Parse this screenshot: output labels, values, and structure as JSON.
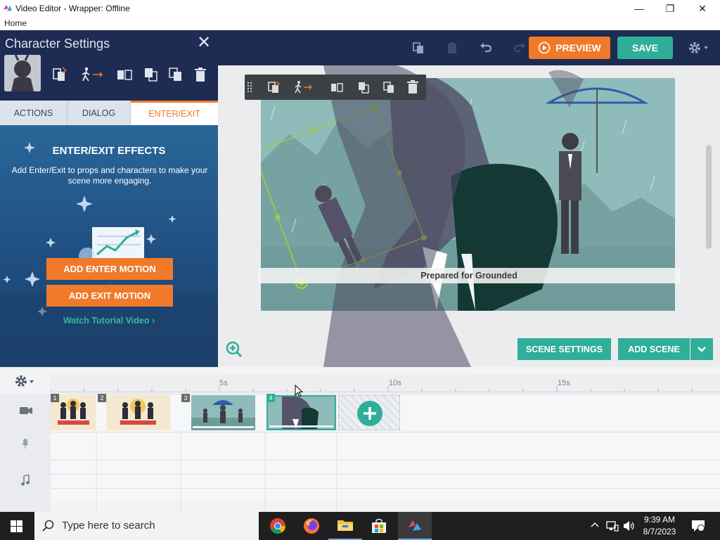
{
  "window": {
    "title": "Video Editor - Wrapper: Offline",
    "minimize": "—",
    "maximize": "❐",
    "close": "✕"
  },
  "menu": {
    "home": "Home"
  },
  "toolbar": {
    "preview_label": "PREVIEW",
    "save_label": "SAVE"
  },
  "panel": {
    "title": "Character Settings",
    "tabs": [
      {
        "label": "ACTIONS"
      },
      {
        "label": "DIALOG"
      },
      {
        "label": "ENTER/EXIT"
      }
    ],
    "active_tab": "ENTER/EXIT",
    "effects": {
      "title": "ENTER/EXIT EFFECTS",
      "description": "Add Enter/Exit to props and characters to make your scene more engaging.",
      "enter_button": "ADD ENTER MOTION",
      "exit_button": "ADD EXIT MOTION",
      "tutorial_link": "Watch Tutorial Video"
    }
  },
  "stage": {
    "caption": "Prepared for Grounded",
    "scene_settings_button": "SCENE SETTINGS",
    "add_scene_button": "ADD SCENE"
  },
  "timeline": {
    "ticks": [
      "5s",
      "10s",
      "15s"
    ],
    "scenes": [
      {
        "number": "1"
      },
      {
        "number": "2"
      },
      {
        "number": "3"
      },
      {
        "number": "4"
      }
    ]
  },
  "taskbar": {
    "search_placeholder": "Type here to search",
    "time": "9:39 AM",
    "date": "8/7/2023"
  },
  "colors": {
    "accent_orange": "#f07a2a",
    "accent_teal": "#2fae9a",
    "navy": "#1e2b52"
  }
}
